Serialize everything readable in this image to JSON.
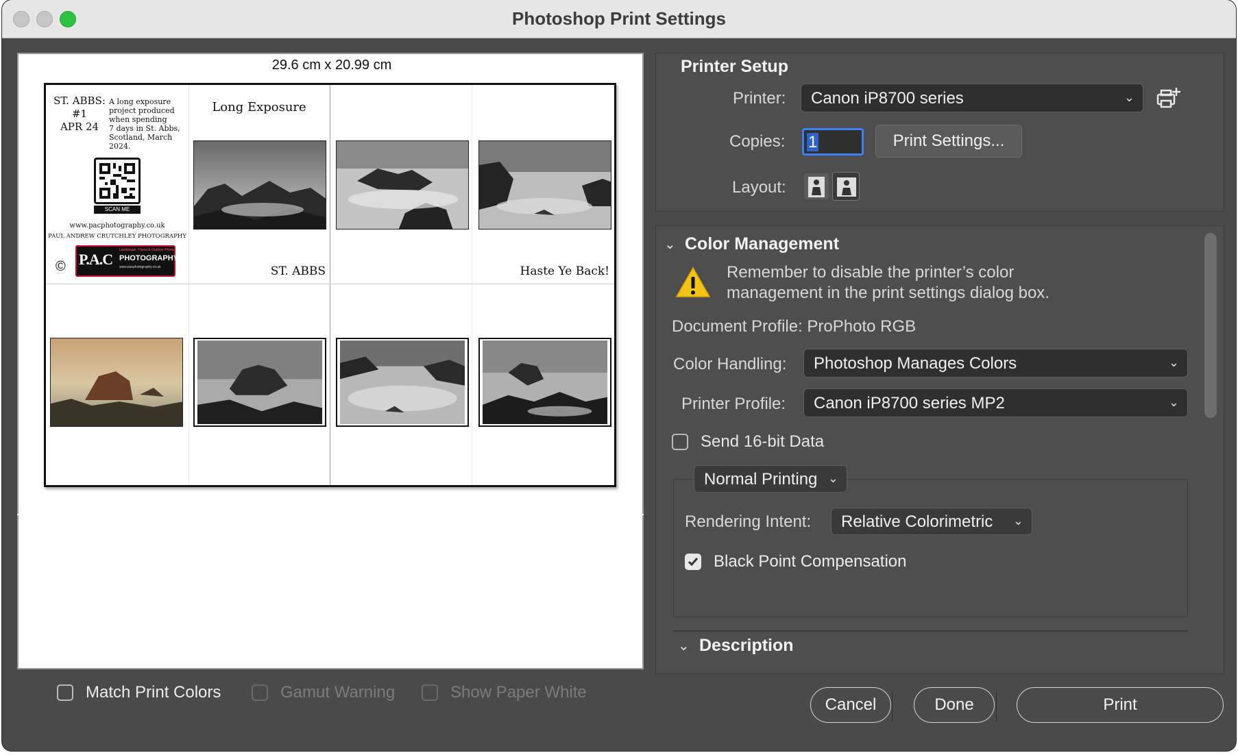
{
  "window": {
    "title": "Photoshop Print Settings"
  },
  "preview": {
    "dimensions": "29.6 cm x 20.99 cm",
    "sheet": {
      "header_left": "ST. ABBS:",
      "header_number": "#1",
      "header_date": "APR 24",
      "description": [
        "A long exposure",
        "project produced",
        "when spending",
        "7 days in St. Abbs,",
        "Scotland, March",
        "2024."
      ],
      "qr_caption": "SCAN ME",
      "website": "www.pacphotography.co.uk",
      "photographer": "PAUL ANDREW CRUTCHLEY PHOTOGRAPHY",
      "logo_copyright": "©",
      "logo_text": "P.A.C",
      "logo_sub": "PHOTOGRAPHY",
      "logo_tagline": "Landscape, Travel & Outdoor Photography",
      "logo_url": "www.pacphotography.co.uk",
      "long_exposure": "Long Exposure",
      "st_abbs": "ST. ABBS",
      "haste_ye_back": "Haste Ye Back!"
    }
  },
  "preview_options": {
    "match_print_colors": "Match Print Colors",
    "gamut_warning": "Gamut Warning",
    "show_paper_white": "Show Paper White"
  },
  "printer_setup": {
    "heading": "Printer Setup",
    "printer_label": "Printer:",
    "printer_value": "Canon iP8700 series",
    "copies_label": "Copies:",
    "copies_value": "1",
    "print_settings_button": "Print Settings...",
    "layout_label": "Layout:"
  },
  "color_management": {
    "heading": "Color Management",
    "warning_line1": "Remember to disable the printer’s color",
    "warning_line2": "management in the print settings dialog box.",
    "document_profile": "Document Profile: ProPhoto RGB",
    "color_handling_label": "Color Handling:",
    "color_handling_value": "Photoshop Manages Colors",
    "printer_profile_label": "Printer Profile:",
    "printer_profile_value": "Canon iP8700 series MP2",
    "send_16bit": "Send 16-bit Data",
    "normal_printing": "Normal Printing",
    "rendering_intent_label": "Rendering Intent:",
    "rendering_intent_value": "Relative Colorimetric",
    "black_point": "Black Point Compensation",
    "send_16bit_checked": false,
    "black_point_checked": true
  },
  "description": {
    "heading": "Description"
  },
  "buttons": {
    "cancel": "Cancel",
    "done": "Done",
    "print": "Print"
  },
  "colors": {
    "window_bg": "#4a4a4a",
    "titlebar_bg": "#e6e6e6",
    "close": "#c6c6c6",
    "minimize": "#c6c6c6",
    "zoom": "#2ec245",
    "warning": "#f3c316"
  }
}
